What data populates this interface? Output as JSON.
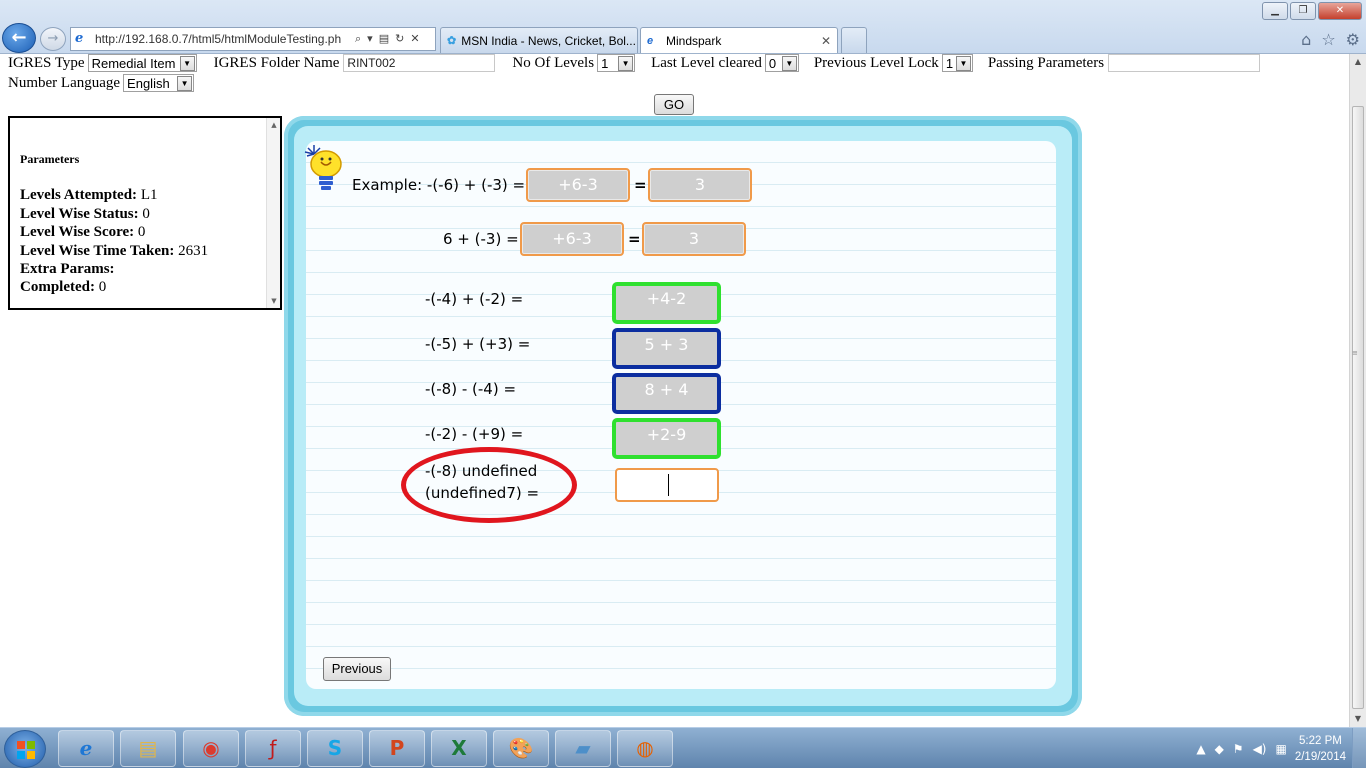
{
  "browser": {
    "window_buttons": {
      "minimize": "▁",
      "restore": "❐",
      "close": "✕"
    },
    "address": "http://192.168.0.7/html5/htmlModuleTesting.ph",
    "tabs": [
      {
        "label": "MSN India - News, Cricket, Bol...",
        "active": false
      },
      {
        "label": "Mindspark",
        "active": true
      }
    ]
  },
  "form": {
    "igres_type_label": "IGRES Type",
    "igres_type_value": "Remedial Item",
    "folder_label": "IGRES Folder Name",
    "folder_value": "RINT002",
    "levels_label": "No Of Levels",
    "levels_value": "1",
    "last_cleared_label": "Last Level cleared",
    "last_cleared_value": "0",
    "prev_lock_label": "Previous Level Lock",
    "prev_lock_value": "1",
    "passing_label": "Passing Parameters",
    "passing_value": "",
    "language_label": "Number Language",
    "language_value": "English",
    "go_label": "GO"
  },
  "params": {
    "title": "Parameters",
    "rows": [
      {
        "label": "Levels Attempted:",
        "value": "L1"
      },
      {
        "label": "Level Wise Status:",
        "value": "0"
      },
      {
        "label": "Level Wise Score:",
        "value": "0"
      },
      {
        "label": "Level Wise Time Taken:",
        "value": "2631"
      },
      {
        "label": "Extra Params:",
        "value": ""
      },
      {
        "label": "Completed:",
        "value": "0"
      }
    ]
  },
  "activity": {
    "example": {
      "label": "Example:",
      "q1": "-(-6) + (-3) =",
      "a1_step": "+6-3",
      "a1_result": "3",
      "q2": "6 + (-3) =",
      "a2_step": "+6-3",
      "a2_result": "3",
      "equals": "="
    },
    "questions": [
      {
        "text": "-(-4) + (-2) =",
        "answer": "+4-2",
        "state": "correct"
      },
      {
        "text": "-(-5) + (+3) =",
        "answer": "5 + 3",
        "state": "wrong"
      },
      {
        "text": "-(-8) - (-4) =",
        "answer": "8 + 4",
        "state": "wrong"
      },
      {
        "text": "-(-2) - (+9) =",
        "answer": "+2-9",
        "state": "correct"
      }
    ],
    "current": {
      "line1": "-(-8) undefined",
      "line2": "(undefined7) =",
      "answer": ""
    },
    "previous_label": "Previous",
    "colors": {
      "correct": "#2fe02f",
      "wrong": "#0c2ea0",
      "highlight": "#e0161e"
    }
  },
  "taskbar": {
    "apps": [
      "internet-explorer",
      "file-explorer",
      "chrome",
      "flash",
      "skype",
      "powerpoint",
      "excel",
      "paint",
      "notepad",
      "firefox"
    ],
    "time": "5:22 PM",
    "date": "2/19/2014"
  }
}
